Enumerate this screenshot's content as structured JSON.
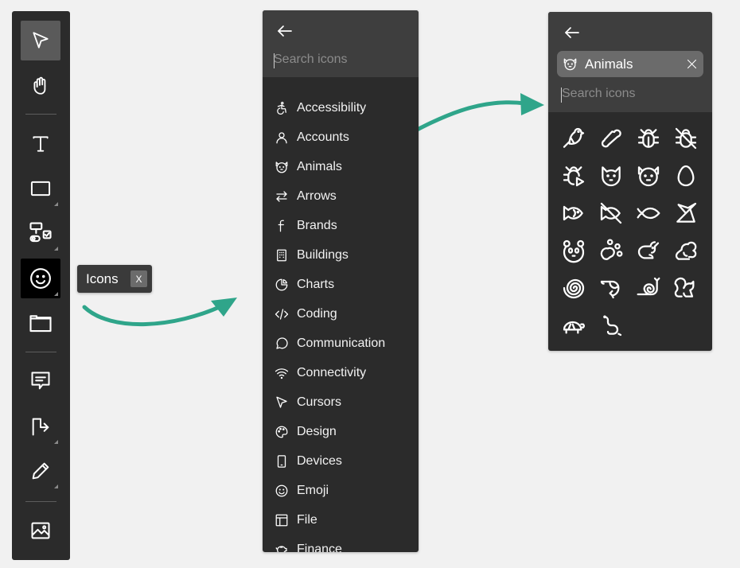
{
  "toolbar": {
    "tools": [
      {
        "name": "select-tool",
        "icon": "cursor-arrow-icon"
      },
      {
        "name": "hand-tool",
        "icon": "hand-icon"
      },
      {
        "name": "text-tool",
        "icon": "text-t-icon"
      },
      {
        "name": "rectangle-tool",
        "icon": "rectangle-icon"
      },
      {
        "name": "components-tool",
        "icon": "components-icon"
      },
      {
        "name": "icons-tool",
        "icon": "smiley-icon"
      },
      {
        "name": "frame-tool",
        "icon": "folder-frame-icon"
      },
      {
        "name": "comment-tool",
        "icon": "comment-icon"
      },
      {
        "name": "connector-tool",
        "icon": "connector-icon"
      },
      {
        "name": "pen-tool",
        "icon": "pencil-icon"
      },
      {
        "name": "image-tool",
        "icon": "image-icon"
      }
    ]
  },
  "tooltip": {
    "label": "Icons",
    "shortcut": "X"
  },
  "category_panel": {
    "search_placeholder": "Search icons",
    "categories": [
      "Accessibility",
      "Accounts",
      "Animals",
      "Arrows",
      "Brands",
      "Buildings",
      "Charts",
      "Coding",
      "Communication",
      "Connectivity",
      "Cursors",
      "Design",
      "Devices",
      "Emoji",
      "File",
      "Finance"
    ]
  },
  "animals_panel": {
    "chip_label": "Animals",
    "search_placeholder": "Search icons",
    "icons": [
      "bird-icon",
      "bone-icon",
      "bug-icon",
      "bug-off-icon",
      "bug-play-icon",
      "cat-icon",
      "dog-icon",
      "egg-icon",
      "fish-icon",
      "fish-off-icon",
      "fish-simple-icon",
      "origami-icon",
      "panda-icon",
      "paw-print-icon",
      "rabbit-icon",
      "squirrel-icon",
      "shell-icon",
      "shrimp-icon",
      "snail-icon",
      "squirrel-alt-icon",
      "turtle-icon",
      "worm-icon"
    ]
  },
  "colors": {
    "panel_bg": "#2b2b2b",
    "panel_header_bg": "#3e3e3e",
    "arrow_teal": "#2fa58a",
    "page_bg": "#f1f1f1"
  }
}
